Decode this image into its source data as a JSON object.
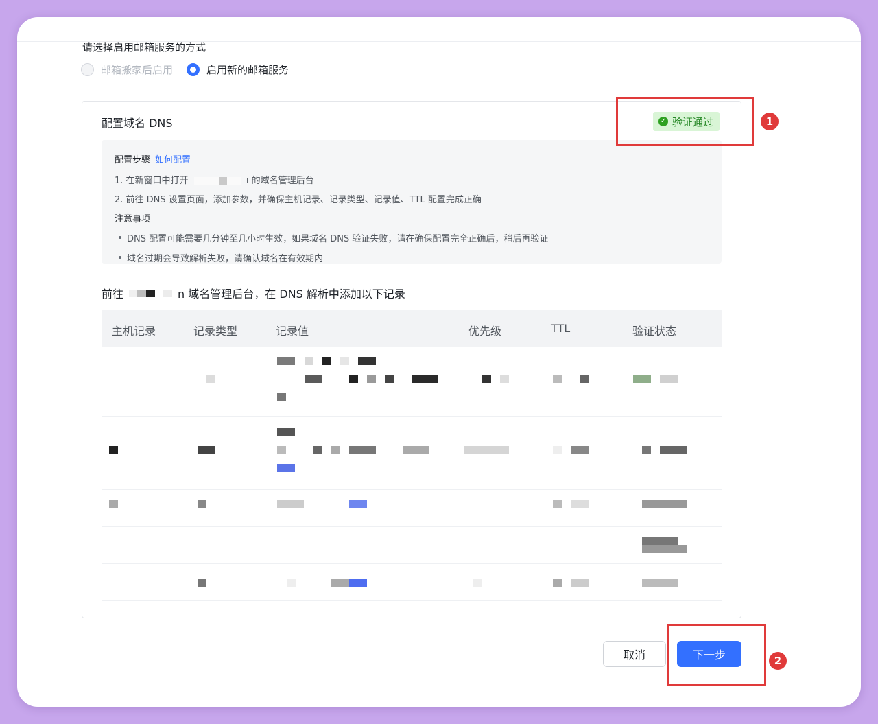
{
  "form": {
    "question": "请选择启用邮箱服务的方式",
    "options": [
      {
        "label": "邮箱搬家后启用",
        "checked": false,
        "disabled": true
      },
      {
        "label": "启用新的邮箱服务",
        "checked": true,
        "disabled": false
      }
    ]
  },
  "dns": {
    "title": "配置域名 DNS",
    "status": "验证通过",
    "guide": {
      "steps_title": "配置步骤",
      "how_link": "如何配置",
      "step1_prefix": "1. 在新窗口中打开",
      "step1_suffix": "ı 的域名管理后台",
      "step2": "2. 前往 DNS 设置页面，添加参数，并确保主机记录、记录类型、记录值、TTL 配置完成正确",
      "notice_title": "注意事项",
      "notes": [
        "DNS 配置可能需要几分钟至几小时生效，如果域名 DNS 验证失败，请在确保配置完全正确后，稍后再验证",
        "域名过期会导致解析失败，请确认域名在有效期内"
      ]
    },
    "goto_prefix": "前往",
    "goto_suffix": "n 域名管理后台，在 DNS 解析中添加以下记录",
    "table": {
      "columns": [
        "主机记录",
        "记录类型",
        "记录值",
        "优先级",
        "TTL",
        "验证状态"
      ]
    }
  },
  "actions": {
    "cancel": "取消",
    "next": "下一步"
  },
  "annotations": [
    "1",
    "2"
  ],
  "colors": {
    "accent": "#3370ff",
    "success": "#2ea121",
    "annotation": "#e03a3a",
    "background": "#c7a6ec"
  }
}
